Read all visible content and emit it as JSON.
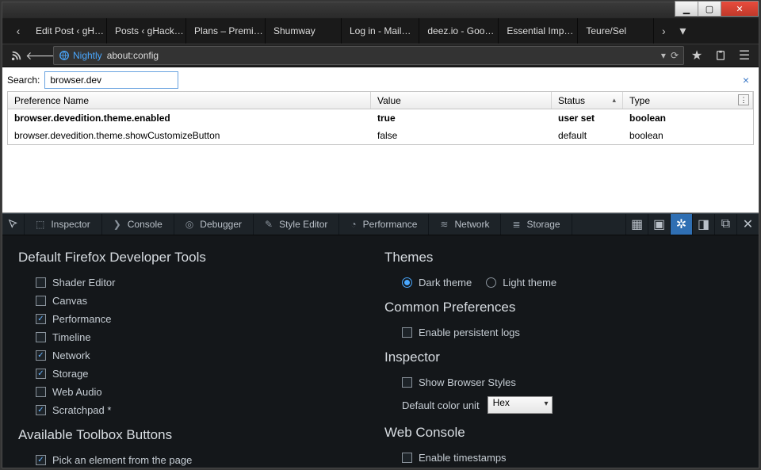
{
  "window": {
    "tabs": [
      "Edit Post ‹ gH…",
      "Posts ‹ gHack…",
      "Plans – Premi…",
      "Shumway",
      "Log in - Mail…",
      "deez.io - Goo…",
      "Essential Imp…",
      "Teure/Sel"
    ],
    "nav": {
      "identity": "Nightly",
      "url": "about:config"
    }
  },
  "aboutconfig": {
    "search_label": "Search:",
    "search_value": "browser.dev",
    "columns": {
      "pref": "Preference Name",
      "value": "Value",
      "status": "Status",
      "type": "Type"
    },
    "rows": [
      {
        "pref": "browser.devedition.theme.enabled",
        "value": "true",
        "status": "user set",
        "type": "boolean",
        "bold": true
      },
      {
        "pref": "browser.devedition.theme.showCustomizeButton",
        "value": "false",
        "status": "default",
        "type": "boolean",
        "bold": false
      }
    ]
  },
  "devtools": {
    "tabs": [
      "Inspector",
      "Console",
      "Debugger",
      "Style Editor",
      "Performance",
      "Network",
      "Storage"
    ],
    "options": {
      "left_title": "Default Firefox Developer Tools",
      "left_items": [
        {
          "label": "Shader Editor",
          "checked": false
        },
        {
          "label": "Canvas",
          "checked": false
        },
        {
          "label": "Performance",
          "checked": true
        },
        {
          "label": "Timeline",
          "checked": false
        },
        {
          "label": "Network",
          "checked": true
        },
        {
          "label": "Storage",
          "checked": true
        },
        {
          "label": "Web Audio",
          "checked": false
        },
        {
          "label": "Scratchpad *",
          "checked": true
        }
      ],
      "left_title2": "Available Toolbox Buttons",
      "left_items2": [
        {
          "label": "Pick an element from the page",
          "checked": true
        }
      ],
      "themes_title": "Themes",
      "theme_dark": "Dark theme",
      "theme_light": "Light theme",
      "common_title": "Common Preferences",
      "common_persist": "Enable persistent logs",
      "inspector_title": "Inspector",
      "inspector_styles": "Show Browser Styles",
      "color_unit_label": "Default color unit",
      "color_unit_value": "Hex",
      "webconsole_title": "Web Console",
      "webconsole_ts": "Enable timestamps"
    }
  }
}
